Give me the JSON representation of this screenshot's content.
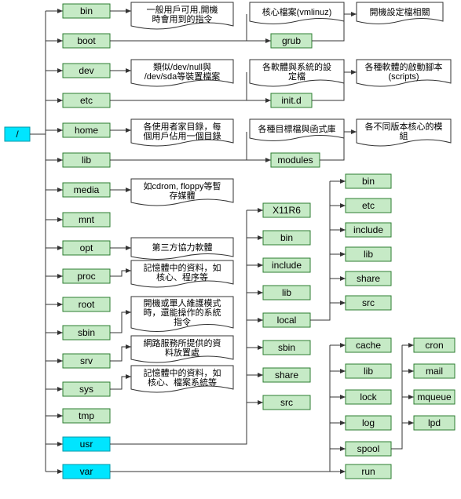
{
  "root": {
    "label": "/"
  },
  "level1": {
    "bin": {
      "label": "bin",
      "note": "一般用戶可用,開機時會用到的指令"
    },
    "boot": {
      "label": "boot",
      "child": {
        "label": "grub",
        "note": "核心檔案(vmlinuz)"
      },
      "note2": "開機設定檔相關"
    },
    "dev": {
      "label": "dev",
      "note": "類似/dev/null與/dev/sda等裝置檔案"
    },
    "etc": {
      "label": "etc",
      "child": {
        "label": "init.d",
        "note": "各軟體與系統的設定檔"
      },
      "note2": "各種軟體的啟動腳本(scripts)"
    },
    "home": {
      "label": "home",
      "note": "各使用者家目錄，每個用戶佔用一個目錄"
    },
    "lib": {
      "label": "lib",
      "child": {
        "label": "modules",
        "note": "各種目標檔與函式庫"
      },
      "note2": "各不同版本核心的模組"
    },
    "media": {
      "label": "media",
      "note": "如cdrom, floppy等暫存媒體"
    },
    "mnt": {
      "label": "mnt"
    },
    "opt": {
      "label": "opt",
      "note": "第三方協力軟體"
    },
    "proc": {
      "label": "proc",
      "note": "記憶體中的資料，如核心、程序等"
    },
    "root": {
      "label": "root"
    },
    "sbin": {
      "label": "sbin",
      "note": "開機或單人維護模式時，還能操作的系統指令"
    },
    "srv": {
      "label": "srv",
      "note": "網路服務所提供的資料放置處"
    },
    "sys": {
      "label": "sys",
      "note": "記憶體中的資料，如核心、檔案系統等"
    },
    "tmp": {
      "label": "tmp"
    },
    "usr": {
      "label": "usr"
    },
    "var": {
      "label": "var"
    }
  },
  "usr_children": [
    "X11R6",
    "bin",
    "include",
    "lib",
    "local",
    "sbin",
    "share",
    "src"
  ],
  "local_children": [
    "bin",
    "etc",
    "include",
    "lib",
    "share",
    "src"
  ],
  "var_children": [
    "cache",
    "lib",
    "lock",
    "log",
    "spool",
    "run"
  ],
  "spool_children": [
    "cron",
    "mail",
    "mqueue",
    "lpd"
  ],
  "colors": {
    "green": "#c6eac6",
    "cyan": "#00e5ff"
  }
}
